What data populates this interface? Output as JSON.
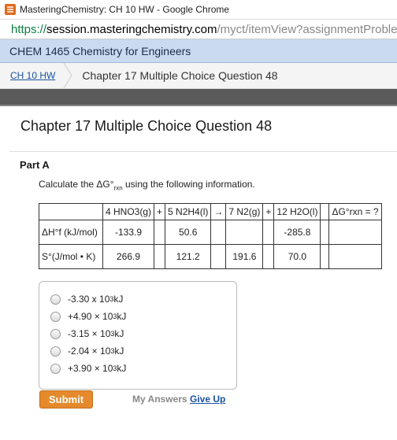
{
  "window": {
    "title": "MasteringChemistry: CH 10 HW - Google Chrome"
  },
  "address": {
    "scheme": "https://",
    "host": "session.masteringchemistry.com",
    "path": "/myct/itemView?assignmentProble"
  },
  "course": {
    "name": "CHEM 1465 Chemistry for Engineers"
  },
  "breadcrumb": {
    "link": "CH 10 HW",
    "current": "Chapter 17 Multiple Choice Question 48"
  },
  "question": {
    "title": "Chapter 17 Multiple Choice Question 48",
    "part": "Part A",
    "instruction_pre": "Calculate the ΔG°",
    "instruction_sub": "rxn",
    "instruction_post": " using the following information."
  },
  "table": {
    "header": {
      "hno3": "4 HNO3(g)",
      "plus1": "+",
      "n2h4": "5 N2H4(l)",
      "arrow": "→",
      "n2": "7 N2(g)",
      "plus2": "+",
      "h2o": "12 H2O(l)",
      "dg": "ΔG°rxn = ?"
    },
    "row1": {
      "label": "ΔH°f (kJ/mol)",
      "hno3": "-133.9",
      "n2h4": "50.6",
      "n2": "",
      "h2o": "-285.8"
    },
    "row2": {
      "label": "S°(J/mol • K)",
      "hno3": "266.9",
      "n2h4": "121.2",
      "n2": "191.6",
      "h2o": "70.0"
    }
  },
  "choices": [
    {
      "mantissa": "-3.30 x 10",
      "exp": "3",
      "unit": " kJ"
    },
    {
      "mantissa": "+4.90 × 10",
      "exp": "3",
      "unit": " kJ"
    },
    {
      "mantissa": "-3.15 × 10",
      "exp": "3",
      "unit": " kJ"
    },
    {
      "mantissa": "-2.04 × 10",
      "exp": "3",
      "unit": " kJ"
    },
    {
      "mantissa": "+3.90 × 10",
      "exp": "3",
      "unit": " kJ"
    }
  ],
  "actions": {
    "submit": "Submit",
    "my_answers": "My Answers",
    "give_up": "Give Up"
  },
  "colors": {
    "submit_bg": "#e58a2c",
    "link": "#1a52a3",
    "course_bar": "#c9daf1"
  }
}
